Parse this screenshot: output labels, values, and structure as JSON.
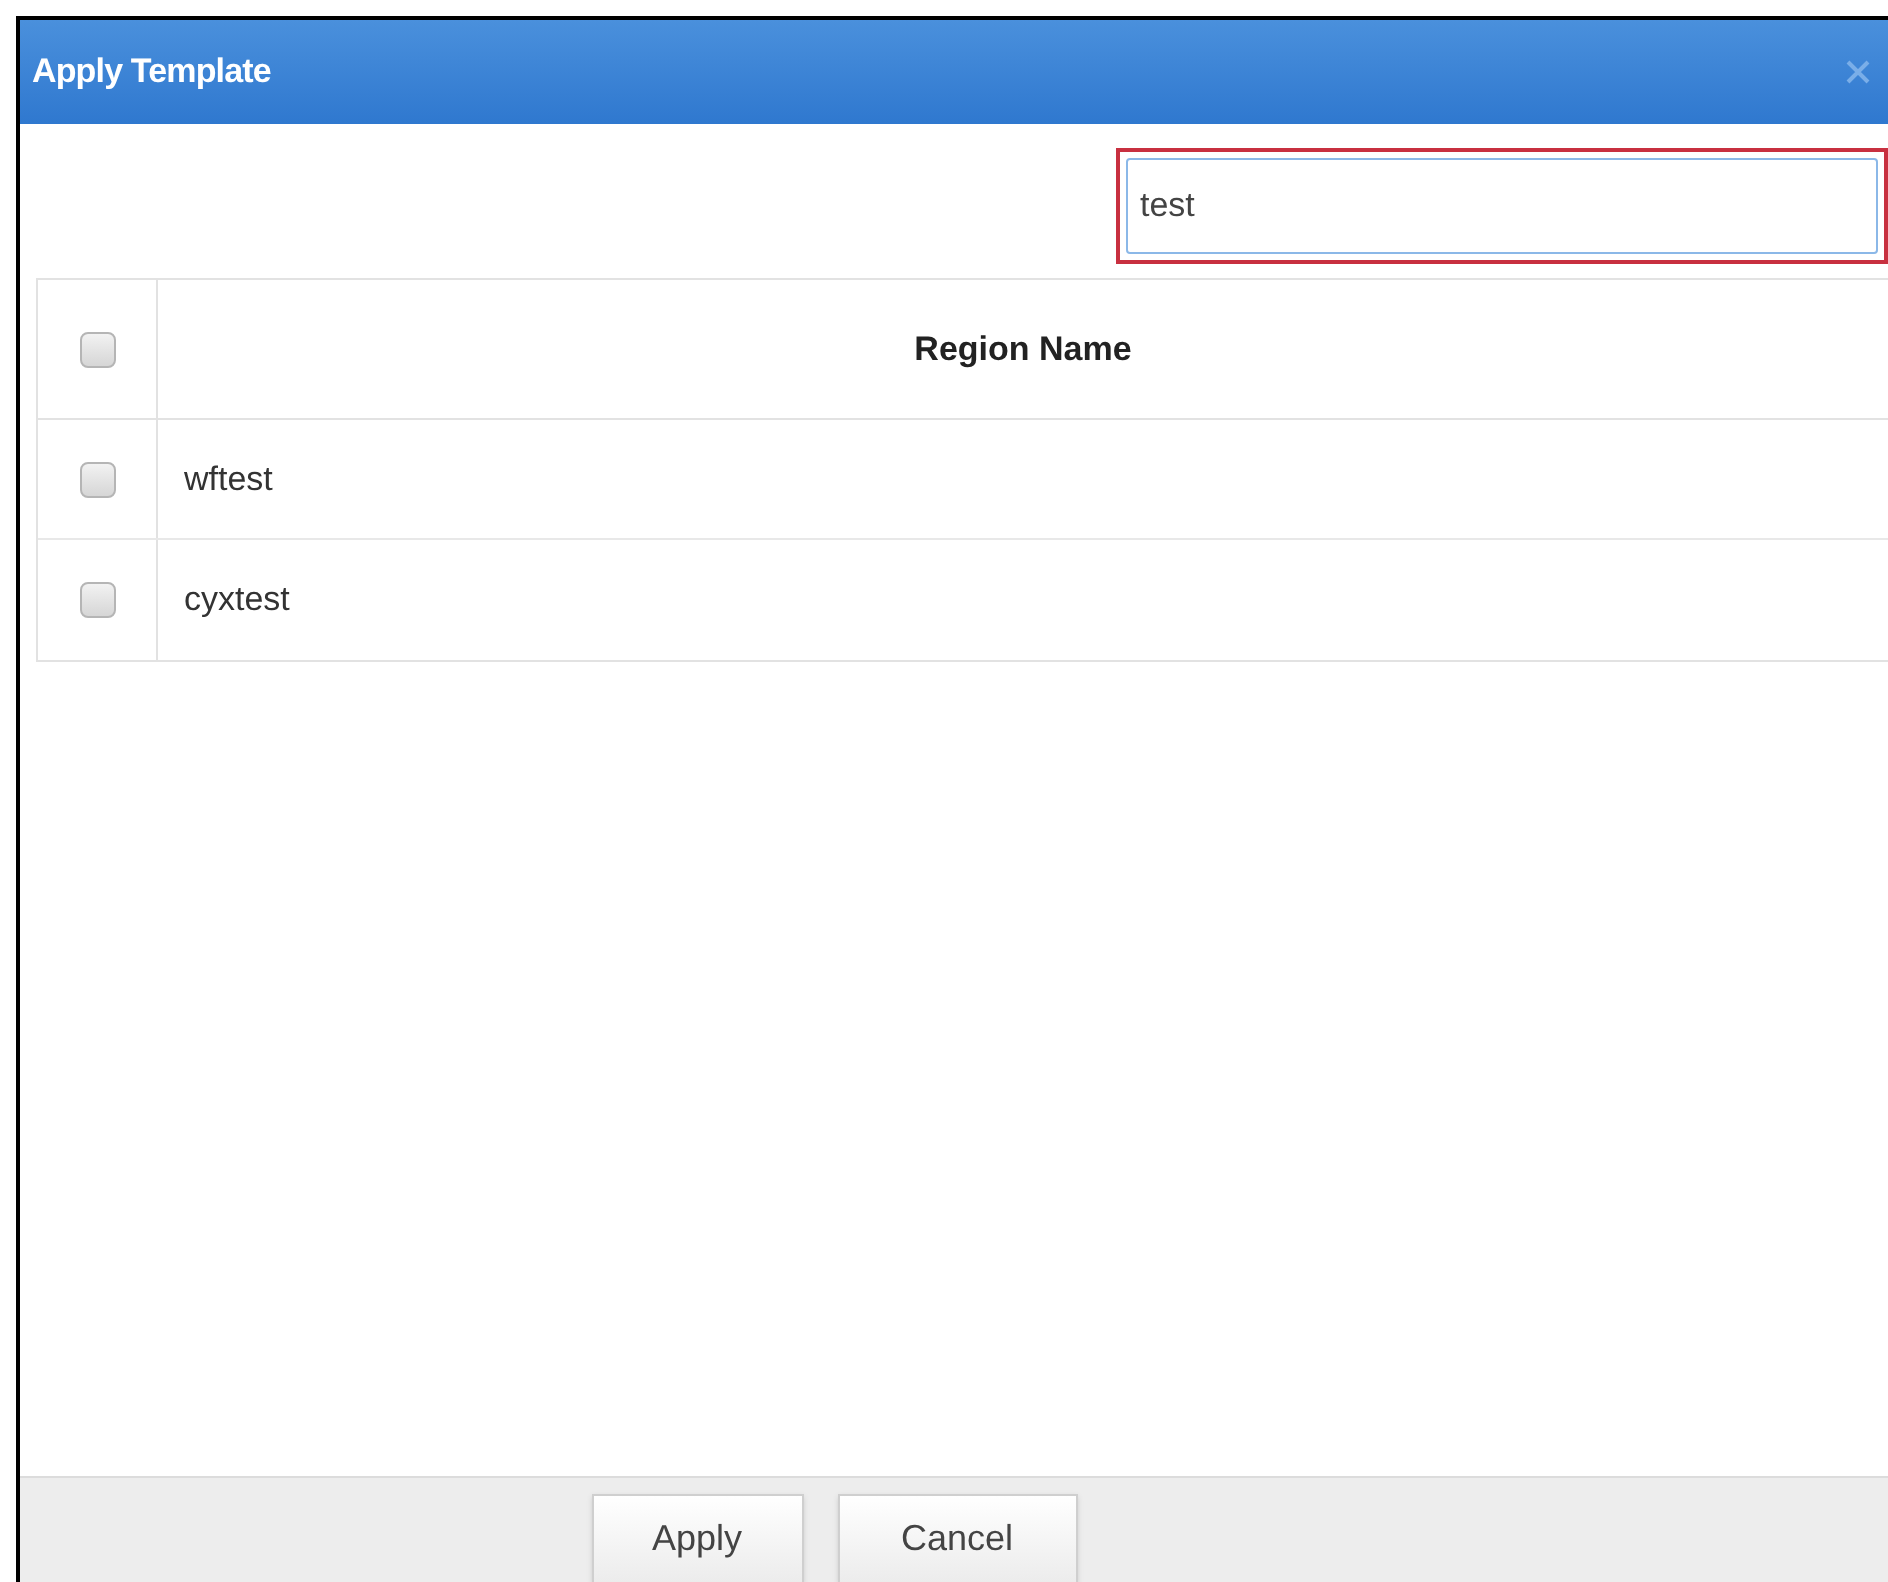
{
  "dialog": {
    "title": "Apply Template"
  },
  "search": {
    "value": "test"
  },
  "table": {
    "columns": [
      {
        "label": "Region Name"
      }
    ],
    "header_checked": false,
    "rows": [
      {
        "name": "wftest",
        "checked": false
      },
      {
        "name": "cyxtest",
        "checked": false
      }
    ]
  },
  "buttons": [
    {
      "label": "Apply"
    },
    {
      "label": "Cancel"
    }
  ]
}
